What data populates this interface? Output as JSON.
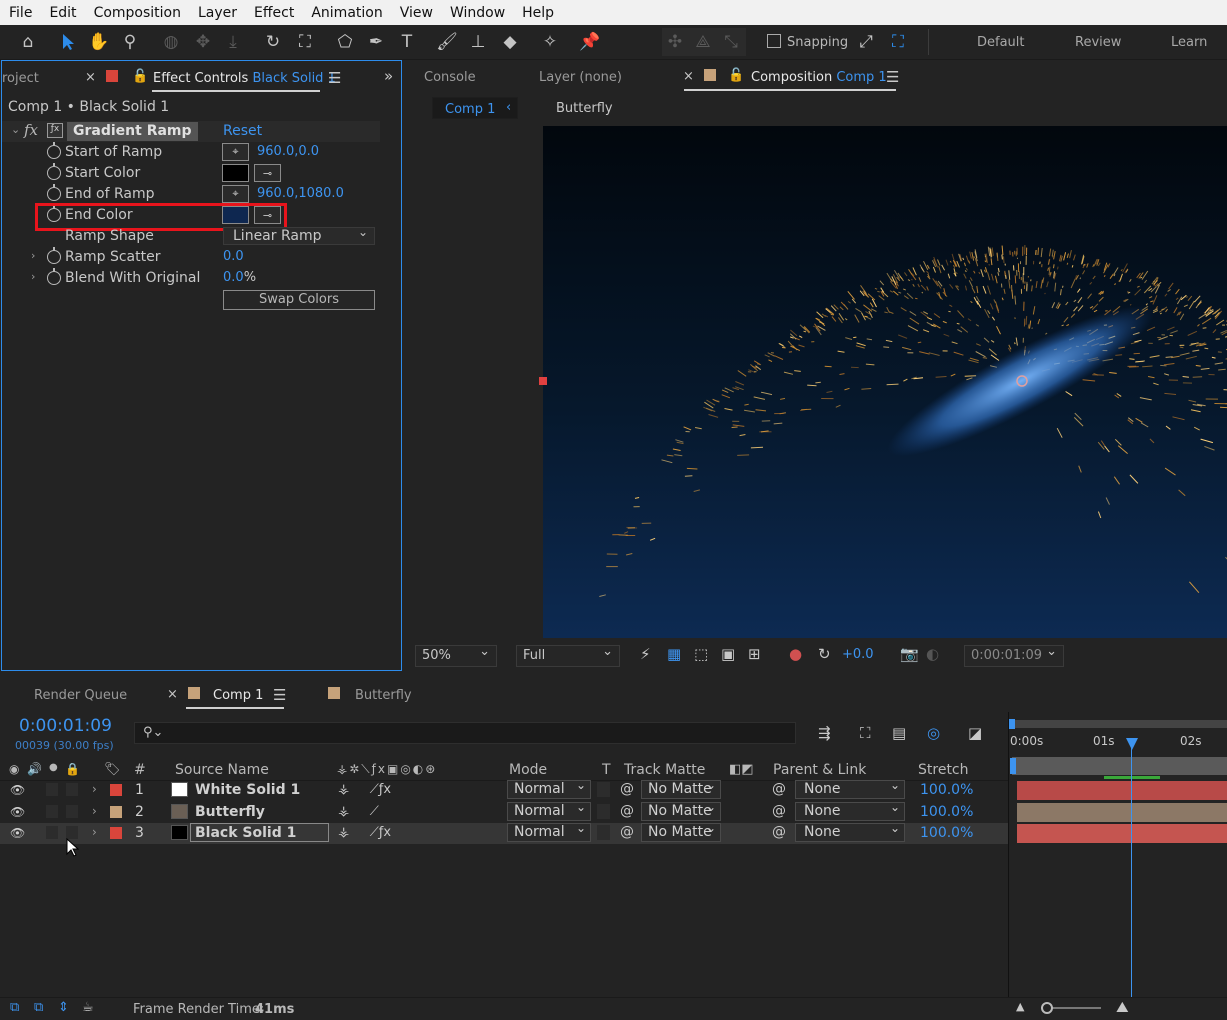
{
  "menu": [
    "File",
    "Edit",
    "Composition",
    "Layer",
    "Effect",
    "Animation",
    "View",
    "Window",
    "Help"
  ],
  "toolbar": {
    "snapping_label": "Snapping",
    "workspaces": [
      "Default",
      "Review",
      "Learn"
    ]
  },
  "effect_panel": {
    "project_tab": "roject",
    "tab_prefix": "Effect Controls",
    "tab_layer": "Black Solid 1",
    "breadcrumb": "Comp 1 • Black Solid 1",
    "effect_name": "Gradient Ramp",
    "reset": "Reset",
    "props": {
      "start_of_ramp": {
        "label": "Start of Ramp",
        "value": "960.0,0.0"
      },
      "start_color": {
        "label": "Start Color",
        "color": "#000000"
      },
      "end_of_ramp": {
        "label": "End of Ramp",
        "value": "960.0,1080.0"
      },
      "end_color": {
        "label": "End Color",
        "color": "#0e2750"
      },
      "ramp_shape": {
        "label": "Ramp Shape",
        "value": "Linear Ramp"
      },
      "ramp_scatter": {
        "label": "Ramp Scatter",
        "value": "0.0"
      },
      "blend": {
        "label": "Blend With Original",
        "value": "0.0",
        "unit": "%"
      }
    },
    "swap_button": "Swap Colors",
    "highlight_color": "#e8141c"
  },
  "comp_panel": {
    "tabs": {
      "console": "Console",
      "layer": "Layer (none)",
      "composition_prefix": "Composition",
      "composition_name": "Comp 1"
    },
    "subtabs": [
      "Comp 1",
      "Butterfly"
    ],
    "zoom": "50%",
    "resolution": "Full",
    "exposure": "+0.0",
    "timecode": "0:00:01:09"
  },
  "timeline": {
    "tabs": {
      "render_queue": "Render Queue",
      "comp": "Comp 1",
      "butterfly": "Butterfly"
    },
    "timecode": "0:00:01:09",
    "frame_info": "00039 (30.00 fps)",
    "ruler": [
      "0:00s",
      "01s",
      "02s"
    ],
    "headers": {
      "num": "#",
      "source": "Source Name",
      "mode": "Mode",
      "t": "T",
      "track_matte": "Track Matte",
      "parent": "Parent & Link",
      "stretch": "Stretch"
    },
    "layers": [
      {
        "num": "1",
        "name": "White Solid 1",
        "label_color": "#d9453b",
        "thumb_color": "#ffffff",
        "mode": "Normal",
        "matte": "No Matte",
        "parent": "None",
        "stretch": "100.0%",
        "bar_color": "#b84a48"
      },
      {
        "num": "2",
        "name": "Butterfly",
        "label_color": "#c6a27a",
        "thumb_color": "#6a5f55",
        "mode": "Normal",
        "matte": "No Matte",
        "parent": "None",
        "stretch": "100.0%",
        "bar_color": "#8c7866"
      },
      {
        "num": "3",
        "name": "Black Solid 1",
        "label_color": "#d9453b",
        "thumb_color": "#000000",
        "mode": "Normal",
        "matte": "No Matte",
        "parent": "None",
        "stretch": "100.0%",
        "bar_color": "#c55550"
      }
    ],
    "footer_label": "Frame Render Time:",
    "footer_value": "41ms"
  }
}
